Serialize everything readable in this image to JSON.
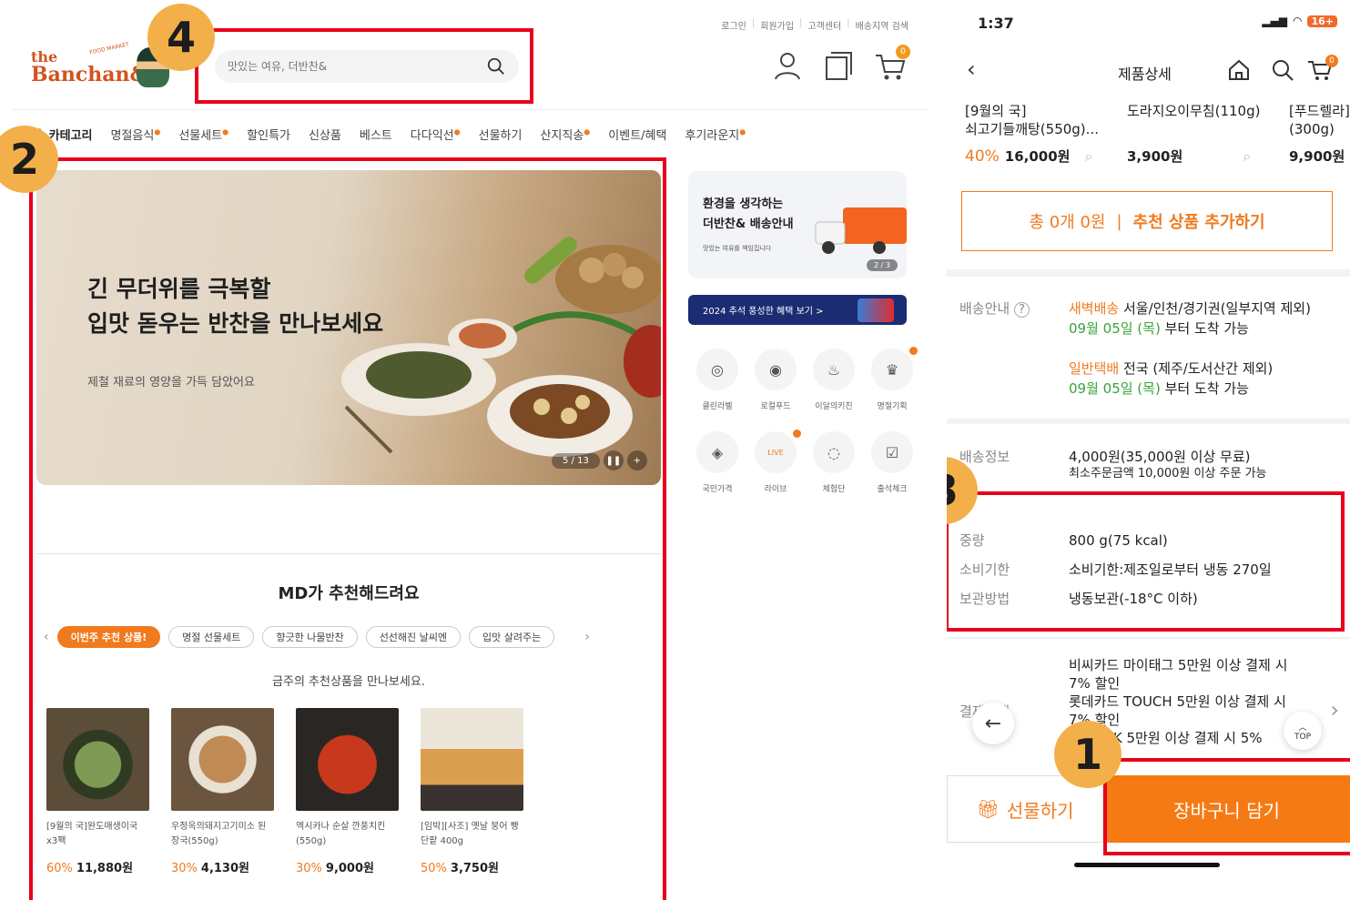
{
  "web": {
    "top_links": [
      "로그인",
      "회원가입",
      "고객센터",
      "배송지역 검색"
    ],
    "logo": {
      "line1": "the",
      "line2": "Banchan&",
      "tag": "FOOD MARKET"
    },
    "search": {
      "placeholder": "맛있는 여유, 더반찬&"
    },
    "cart_count": "0",
    "nav": {
      "category_label": "카테고리",
      "items": [
        "명절음식",
        "선물세트",
        "할인특가",
        "신상품",
        "베스트",
        "다다익선",
        "선물하기",
        "산지직송",
        "이벤트/혜택",
        "후기라운지"
      ]
    },
    "hero": {
      "line1": "긴 무더위를 극복할",
      "line2": "입맛 돋우는 반찬을 만나보세요",
      "sub": "제철 재료의 영양을 가득 담았어요",
      "pager": "5 / 13"
    },
    "md": {
      "title": "MD가 추천해드려요",
      "tabs": [
        "이번주 추천 상품!",
        "명절 선물세트",
        "향긋한 나물반찬",
        "선선해진 날씨엔",
        "입맛 살려주는"
      ],
      "weekly": "금주의 추천상품을 만나보세요.",
      "products": [
        {
          "name": "[9월의 국]완도매생이국 x3팩",
          "discount": "60%",
          "price": "11,880원"
        },
        {
          "name": "우정옥의돼지고기미소 된장국(550g)",
          "discount": "30%",
          "price": "4,130원"
        },
        {
          "name": "엑시카나 순살 깐풍치킨 (550g)",
          "discount": "30%",
          "price": "9,000원"
        },
        {
          "name": "[임박][사조] 옛날 붕어 빵 단팥 400g",
          "discount": "50%",
          "price": "3,750원"
        }
      ]
    },
    "banner1": {
      "line1": "환경을 생각하는",
      "line2": "더반찬& 배송안내",
      "sub": "맛있는 여유를 책임집니다",
      "page": "2 / 3"
    },
    "banner2": {
      "text": "2024 추석 풍성한 혜택 보기 >"
    },
    "quick": [
      {
        "label": "클린라벨",
        "icon": "clean-label-icon",
        "glyph": "◎"
      },
      {
        "label": "로컬푸드",
        "icon": "local-food-icon",
        "glyph": "◉"
      },
      {
        "label": "이달의키친",
        "icon": "kitchen-icon",
        "glyph": "♨"
      },
      {
        "label": "명절기획",
        "icon": "holiday-icon",
        "glyph": "♛"
      },
      {
        "label": "국민가격",
        "icon": "price-tag-icon",
        "glyph": "◈"
      },
      {
        "label": "라이브",
        "icon": "live-icon",
        "glyph": "LIVE"
      },
      {
        "label": "체험단",
        "icon": "chat-icon",
        "glyph": "◌"
      },
      {
        "label": "출석체크",
        "icon": "calendar-check-icon",
        "glyph": "☑"
      }
    ]
  },
  "phone": {
    "time": "1:37",
    "battery": "16+",
    "title": "제품상세",
    "cart_count": "0",
    "recommend": [
      {
        "name1": "[9월의 국]",
        "name2": "쇠고기들깨탕(550g)...",
        "discount": "40%",
        "price": "16,000원"
      },
      {
        "name1": "도라지오이무침(110g)",
        "name2": "",
        "discount": "",
        "price": "3,900원"
      },
      {
        "name1": "[푸드렐라]",
        "name2": "(300g)",
        "discount": "",
        "price": "9,900원"
      }
    ],
    "add_box": {
      "total": "총 0개 0원",
      "sep": "|",
      "action": "추천 상품 추가하기"
    },
    "shipping_guide": {
      "label": "배송안내",
      "dawn_type": "새벽배송",
      "dawn_area": " 서울/인천/경기권(일부지역 제외)",
      "dawn_date": "09월 05일 (목)",
      "dawn_suffix": " 부터 도착 가능",
      "normal_type": "일반택배",
      "normal_area": " 전국 (제주/도서산간 제외)",
      "normal_date": "09월 05일 (목)",
      "normal_suffix": " 부터 도착 가능"
    },
    "shipping_info": {
      "label": "배송정보",
      "fee": "4,000원(35,000원 이상 무료)",
      "min": "최소주문금액 10,000원 이상 주문 가능"
    },
    "specs": [
      {
        "label": "중량",
        "value": "800 g(75 kcal)"
      },
      {
        "label": "소비기한",
        "value": "소비기한:제조일로부터 냉동 270일"
      },
      {
        "label": "보관방법",
        "value": "냉동보관(-18°C 이하)"
      }
    ],
    "payment": {
      "label": "결제혜택",
      "lines": [
        "비씨카드 마이태그 5만원 이상 결제 시",
        "7% 할인",
        "롯데카드 TOUCH 5만원 이상 결제 시",
        "7% 할인",
        "KB LINK 5만원 이상 결제 시 5%"
      ]
    },
    "top_label": "TOP",
    "gift_label": "선물하기",
    "cart_label": "장바구니 담기"
  },
  "annotations": [
    "1",
    "2",
    "3",
    "4"
  ],
  "colors": {
    "accent": "#f17a1e",
    "highlight": "#e8001c",
    "badge": "#f3b04a"
  }
}
